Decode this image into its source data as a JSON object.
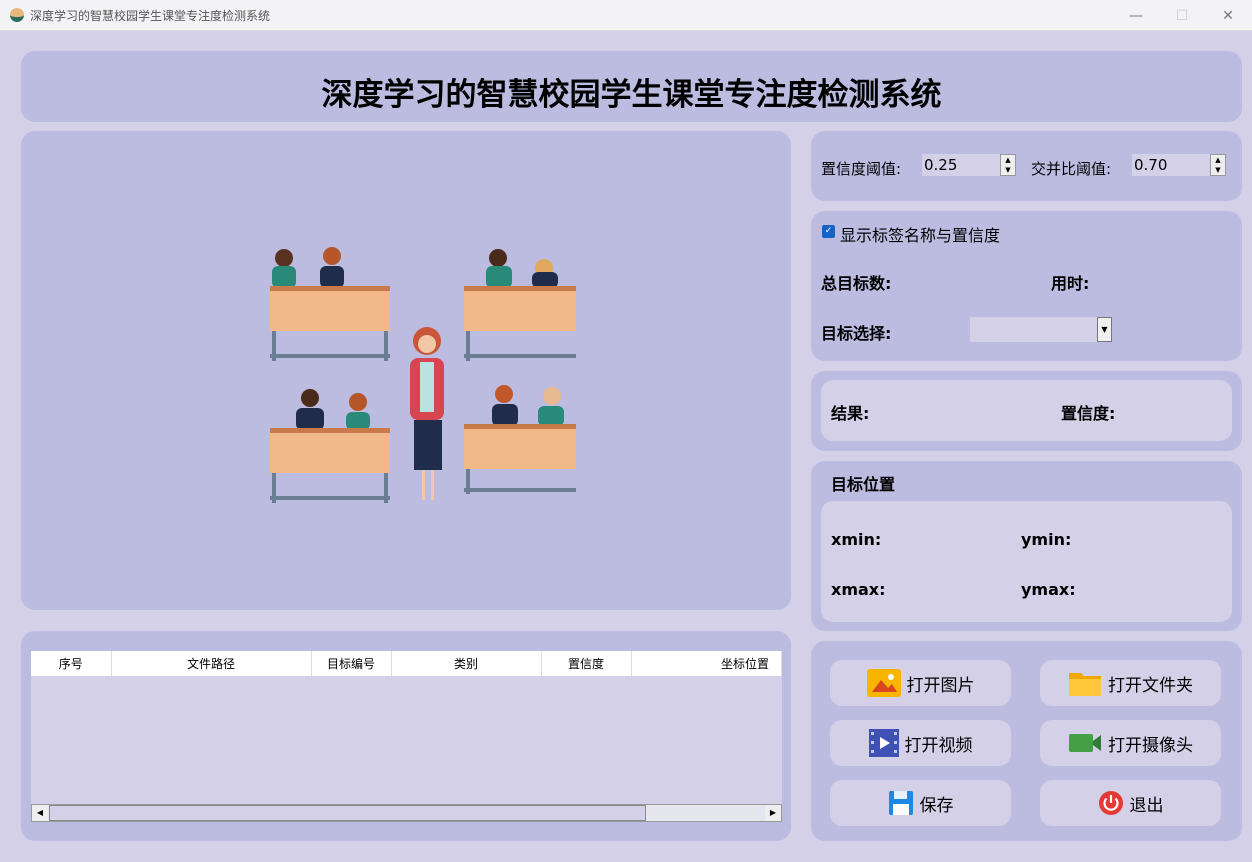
{
  "window": {
    "title": "深度学习的智慧校园学生课堂专注度检测系统",
    "minimize": "—",
    "maximize": "☐",
    "close": "✕"
  },
  "header": {
    "title": "深度学习的智慧校园学生课堂专注度检测系统"
  },
  "params": {
    "conf_label": "置信度阈值:",
    "conf_value": "0.25",
    "iou_label": "交并比阈值:",
    "iou_value": "0.70"
  },
  "options": {
    "show_label": "显示标签名称与置信度",
    "show_checked": true,
    "total_label": "总目标数:",
    "time_label": "用时:",
    "select_label": "目标选择:",
    "select_value": ""
  },
  "result": {
    "result_label": "结果:",
    "conf_label": "置信度:"
  },
  "position": {
    "title": "目标位置",
    "xmin": "xmin:",
    "ymin": "ymin:",
    "xmax": "xmax:",
    "ymax": "ymax:"
  },
  "table": {
    "columns": [
      "序号",
      "文件路径",
      "目标编号",
      "类别",
      "置信度",
      "坐标位置"
    ],
    "rows": []
  },
  "buttons": {
    "open_image": "打开图片",
    "open_folder": "打开文件夹",
    "open_video": "打开视频",
    "open_camera": "打开摄像头",
    "save": "保存",
    "exit": "退出"
  }
}
